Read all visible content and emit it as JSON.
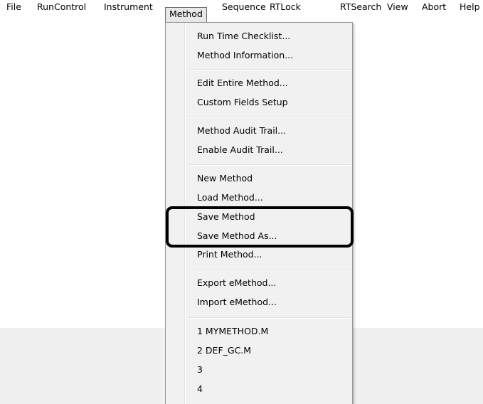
{
  "menubar": {
    "items": [
      {
        "label": "File"
      },
      {
        "label": "RunControl"
      },
      {
        "label": "Instrument"
      },
      {
        "label": "Method"
      },
      {
        "label": "Sequence"
      },
      {
        "label": "RTLock"
      },
      {
        "label": "RTSearch"
      },
      {
        "label": "View"
      },
      {
        "label": "Abort"
      },
      {
        "label": "Help"
      }
    ],
    "active": "Method"
  },
  "method_menu": {
    "groups": [
      [
        "Run Time Checklist...",
        "Method Information..."
      ],
      [
        "Edit Entire Method...",
        "Custom Fields Setup"
      ],
      [
        "Method Audit Trail...",
        "Enable Audit Trail..."
      ],
      [
        "New Method",
        "Load Method...",
        "Save Method",
        "Save Method As...",
        "Print Method..."
      ],
      [
        "Export eMethod...",
        "Import eMethod..."
      ],
      [
        "1 MYMETHOD.M",
        "2 DEF_GC.M",
        "3",
        "4"
      ]
    ]
  },
  "annotation": {
    "highlighted_items": [
      "Save Method",
      "Save Method As..."
    ],
    "color": "#000000"
  }
}
